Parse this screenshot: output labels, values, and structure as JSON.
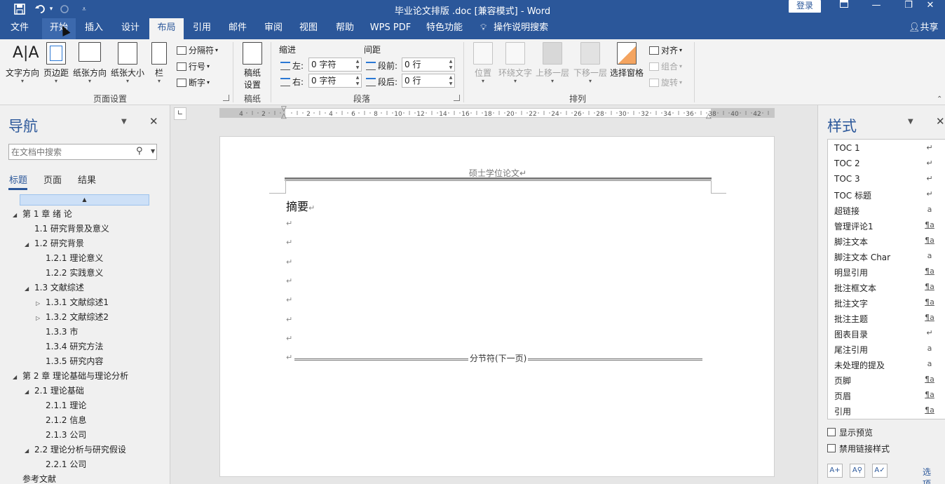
{
  "window": {
    "title": "毕业论文排版 .doc [兼容模式]  -  Word",
    "login_label": "登录",
    "restore_icon": "ribbon-display-icon",
    "minimize_label": "—",
    "maximize_label": "❐",
    "close_label": "✕"
  },
  "quick_access": {
    "save_icon": "save-icon",
    "undo_icon": "undo-icon",
    "redo_icon": "redo-icon",
    "customize_icon": "customize-icon"
  },
  "tabs": [
    {
      "label": "文件"
    },
    {
      "label": "开始"
    },
    {
      "label": "插入"
    },
    {
      "label": "设计"
    },
    {
      "label": "布局"
    },
    {
      "label": "引用"
    },
    {
      "label": "邮件"
    },
    {
      "label": "审阅"
    },
    {
      "label": "视图"
    },
    {
      "label": "帮助"
    },
    {
      "label": "WPS PDF"
    },
    {
      "label": "特色功能"
    }
  ],
  "active_tab": "布局",
  "tell_me": "操作说明搜索",
  "share": "共享",
  "ribbon": {
    "page_setup": {
      "label": "页面设置",
      "text_direction": "文字方向",
      "margins": "页边距",
      "orientation": "纸张方向",
      "size": "纸张大小",
      "columns": "栏",
      "breaks": "分隔符",
      "line_numbers": "行号",
      "hyphenation": "断字"
    },
    "manuscript": {
      "label": "稿纸",
      "settings_line1": "稿纸",
      "settings_line2": "设置"
    },
    "paragraph": {
      "label": "段落",
      "indent_title": "缩进",
      "spacing_title": "间距",
      "left_label": "左:",
      "right_label": "右:",
      "before_label": "段前:",
      "after_label": "段后:",
      "left_value": "0 字符",
      "right_value": "0 字符",
      "before_value": "0 行",
      "after_value": "0 行"
    },
    "arrange": {
      "label": "排列",
      "position": "位置",
      "wrap_text": "环绕文字",
      "bring_forward": "上移一层",
      "send_backward": "下移一层",
      "selection_pane": "选择窗格",
      "align": "对齐",
      "group": "组合",
      "rotate": "旋转"
    }
  },
  "navigation": {
    "title": "导航",
    "search_placeholder": "在文档中搜索",
    "tabs": [
      "标题",
      "页面",
      "结果"
    ],
    "items": [
      {
        "level": 1,
        "toggle": "◢",
        "text": "第 1 章 绪  论"
      },
      {
        "level": 2,
        "toggle": "",
        "text": "1.1 研究背景及意义"
      },
      {
        "level": 2,
        "toggle": "◢",
        "text": "1.2 研究背景"
      },
      {
        "level": 3,
        "toggle": "",
        "text": "1.2.1 理论意义"
      },
      {
        "level": 3,
        "toggle": "",
        "text": "1.2.2 实践意义"
      },
      {
        "level": 2,
        "toggle": "◢",
        "text": "1.3 文献综述"
      },
      {
        "level": 3,
        "toggle": "▷",
        "text": "1.3.1 文献综述1"
      },
      {
        "level": 3,
        "toggle": "▷",
        "text": "1.3.2 文献综述2"
      },
      {
        "level": 3,
        "toggle": "",
        "text": "1.3.3 市"
      },
      {
        "level": 3,
        "toggle": "",
        "text": "1.3.4 研究方法"
      },
      {
        "level": 3,
        "toggle": "",
        "text": "1.3.5 研究内容"
      },
      {
        "level": 1,
        "toggle": "◢",
        "text": "第 2 章 理论基础与理论分析"
      },
      {
        "level": 2,
        "toggle": "◢",
        "text": "2.1 理论基础"
      },
      {
        "level": 3,
        "toggle": "",
        "text": "2.1.1 理论"
      },
      {
        "level": 3,
        "toggle": "",
        "text": "2.1.2 信息"
      },
      {
        "level": 3,
        "toggle": "",
        "text": "2.1.3 公司"
      },
      {
        "level": 2,
        "toggle": "◢",
        "text": "2.2 理论分析与研究假设"
      },
      {
        "level": 3,
        "toggle": "",
        "text": "2.2.1 公司"
      },
      {
        "level": 1,
        "toggle": "",
        "text": "参考文献"
      }
    ]
  },
  "ruler": {
    "labels": [
      "4",
      "2",
      "",
      "2",
      "4",
      "6",
      "8",
      "10",
      "12",
      "14",
      "16",
      "18",
      "20",
      "22",
      "24",
      "26",
      "28",
      "30",
      "32",
      "34",
      "36",
      "38",
      "40",
      "42"
    ]
  },
  "document": {
    "header_text": "硕士学位论文↵",
    "heading": "摘要",
    "paragraph_mark": "↵",
    "section_break": "分节符(下一页)"
  },
  "styles": {
    "title": "样式",
    "items": [
      {
        "name": "TOC 1",
        "icon": "↵"
      },
      {
        "name": "TOC 2",
        "icon": "↵"
      },
      {
        "name": "TOC 3",
        "icon": "↵"
      },
      {
        "name": "TOC 标题",
        "icon": "↵"
      },
      {
        "name": "超链接",
        "icon": "a"
      },
      {
        "name": "管理评论1",
        "icon": "¶a"
      },
      {
        "name": "脚注文本",
        "icon": "¶a"
      },
      {
        "name": "脚注文本 Char",
        "icon": "a"
      },
      {
        "name": "明显引用",
        "icon": "¶a"
      },
      {
        "name": "批注框文本",
        "icon": "¶a"
      },
      {
        "name": "批注文字",
        "icon": "¶a"
      },
      {
        "name": "批注主题",
        "icon": "¶a"
      },
      {
        "name": "图表目录",
        "icon": "↵"
      },
      {
        "name": "尾注引用",
        "icon": "a"
      },
      {
        "name": "未处理的提及",
        "icon": "a"
      },
      {
        "name": "页脚",
        "icon": "¶a"
      },
      {
        "name": "页眉",
        "icon": "¶a"
      },
      {
        "name": "引用",
        "icon": "¶a"
      }
    ],
    "show_preview": "显示预览",
    "disable_linked": "禁用链接样式",
    "options": "选项..."
  }
}
